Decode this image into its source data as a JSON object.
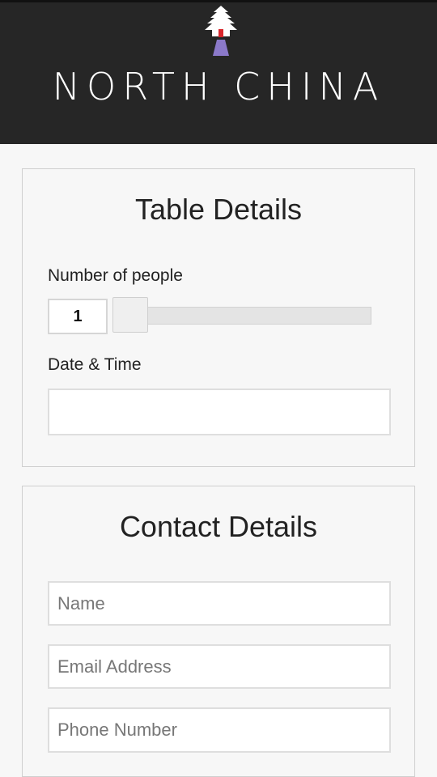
{
  "header": {
    "brand": "NORTH CHINA",
    "logo_icon": "pagoda-tree-logo-icon",
    "background": "#262626"
  },
  "table_details": {
    "title": "Table Details",
    "people_label": "Number of people",
    "people_value": "1",
    "slider_level_fraction": 0,
    "datetime_label": "Date & Time",
    "datetime_value": ""
  },
  "contact_details": {
    "title": "Contact Details",
    "name_placeholder": "Name",
    "email_placeholder": "Email Address",
    "phone_placeholder": "Phone Number"
  }
}
